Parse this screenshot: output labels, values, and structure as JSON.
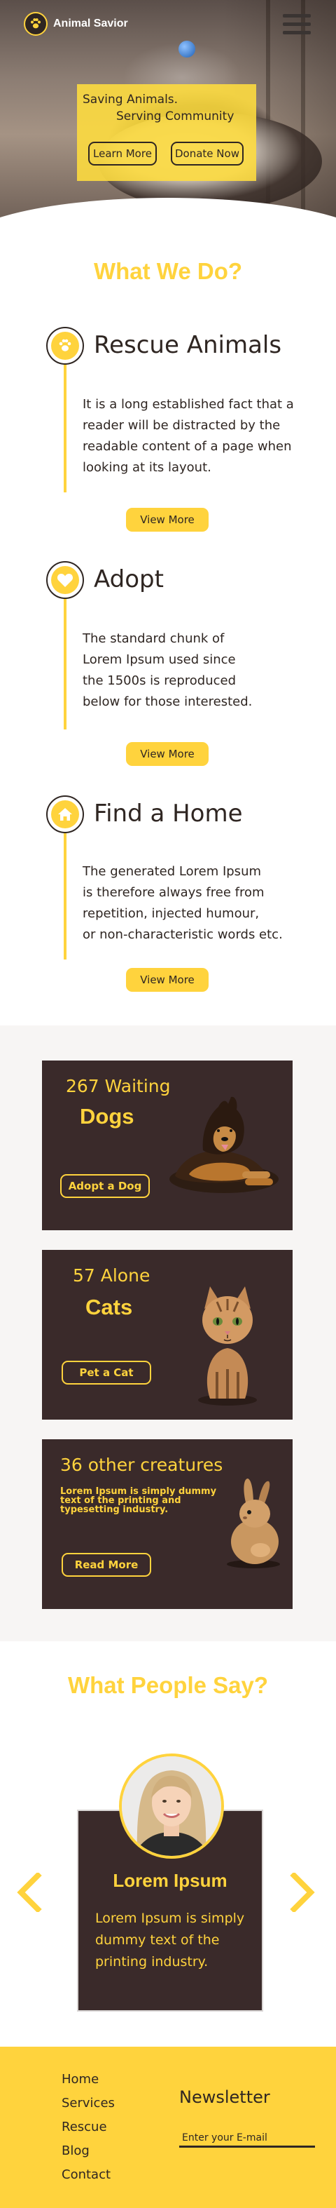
{
  "header": {
    "brand_name": "Animal Savior",
    "logo_icon": "paw-logo-icon",
    "menu_icon": "hamburger-menu-icon"
  },
  "hero": {
    "line1": "Saving Animals.",
    "line2": "Serving Community",
    "learn_more_label": "Learn More",
    "donate_label": "Donate Now"
  },
  "what_we_do": {
    "title": "What We Do?",
    "services": [
      {
        "title": "Rescue Animals",
        "icon": "paw-icon",
        "text": "It is a long established fact that a\nreader will be distracted by the\nreadable content of a page when\nlooking at its layout.",
        "button_label": "View More"
      },
      {
        "title": "Adopt",
        "icon": "heart-icon",
        "text": "The standard chunk of\nLorem Ipsum used since\nthe 1500s is reproduced\nbelow for those interested.",
        "button_label": "View More"
      },
      {
        "title": "Find a Home",
        "icon": "home-icon",
        "text": "The generated Lorem Ipsum\n is therefore always free from\nrepetition, injected humour,\nor non-characteristic words etc.",
        "button_label": "View More"
      }
    ]
  },
  "animals": [
    {
      "count": "267 Waiting",
      "name": "Dogs",
      "button_label": "Adopt a Dog",
      "image": "german-shepherd-dog"
    },
    {
      "count": "57 Alone",
      "name": "Cats",
      "button_label": "Pet a Cat",
      "image": "tabby-kitten"
    },
    {
      "count": "36 other creatures",
      "description": "Lorem Ipsum is simply dummy text of the printing and typesetting industry.",
      "button_label": "Read More",
      "image": "rabbit"
    }
  ],
  "testimonials": {
    "title": "What People Say?",
    "name": "Lorem Ipsum",
    "text": "Lorem Ipsum is simply\ndummy text of the\nprinting industry.",
    "prev_icon": "chevron-left-icon",
    "next_icon": "chevron-right-icon"
  },
  "footer": {
    "links": [
      "Home",
      "Services",
      "Rescue",
      "Blog",
      "Contact"
    ],
    "newsletter_title": "Newsletter",
    "email_placeholder": "Enter your E-mail"
  },
  "colors": {
    "accent_yellow": "#ffd33d",
    "dark_brown": "#3a2a2a",
    "light_gray_bg": "#f7f5f4"
  }
}
